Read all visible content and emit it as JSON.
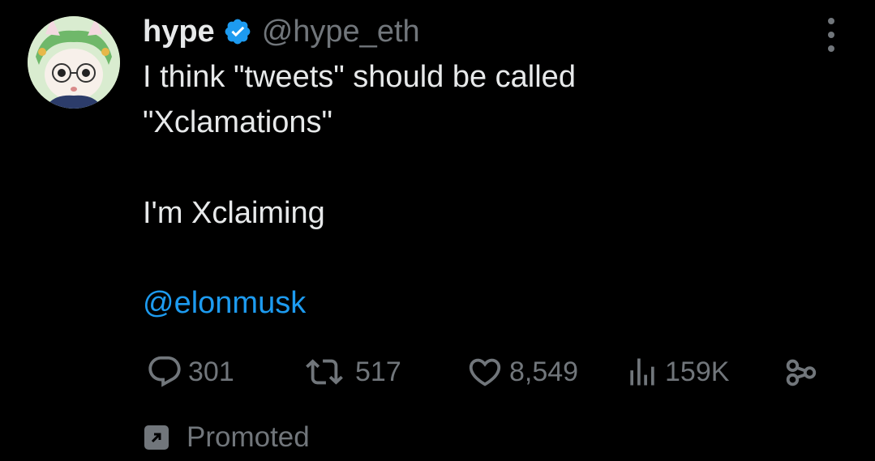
{
  "author": {
    "name": "hype",
    "handle": "@hype_eth",
    "verified": true
  },
  "tweet": {
    "lines": [
      "I think \"tweets\" should be called",
      "\"Xclamations\"",
      "I'm Xclaiming"
    ],
    "mention": "@elonmusk"
  },
  "actions": {
    "replies": "301",
    "reposts": "517",
    "likes": "8,549",
    "views": "159K"
  },
  "footer": {
    "promoted_label": "Promoted"
  },
  "icons": {
    "more": "more-icon",
    "reply": "reply-icon",
    "repost": "repost-icon",
    "like": "heart-icon",
    "views": "views-icon",
    "share": "share-icon",
    "promoted": "promoted-icon",
    "verified": "verified-badge-icon"
  },
  "colors": {
    "background": "#000000",
    "text": "#e7e9ea",
    "muted": "#71767b",
    "accent": "#1d9bf0"
  }
}
